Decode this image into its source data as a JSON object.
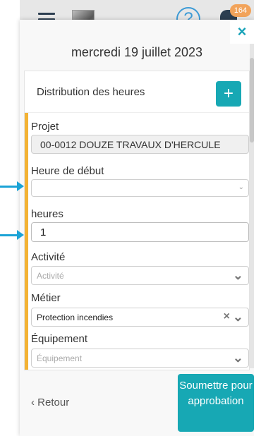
{
  "topbar": {
    "notification_count": "164",
    "help_label": "?"
  },
  "modal": {
    "close_label": "×",
    "date": "mercredi 19 juillet 2023",
    "card_title": "Distribution des heures",
    "add_label": "+",
    "fields": {
      "projet": {
        "label": "Projet",
        "value": "00-0012 DOUZE TRAVAUX D'HERCULE"
      },
      "heure_debut": {
        "label": "Heure de début",
        "value": ""
      },
      "heures": {
        "label": "heures",
        "value": "1"
      },
      "activite": {
        "label": "Activité",
        "placeholder": "Activité"
      },
      "metier": {
        "label": "Métier",
        "value": "Protection incendies"
      },
      "equipement": {
        "label": "Équipement",
        "placeholder": "Équipement"
      }
    },
    "back_label": "‹ Retour",
    "submit_label": "Soumettre pour approbation"
  },
  "colors": {
    "accent_teal": "#17a8b4",
    "accent_yellow": "#f3b233",
    "arrow_blue": "#1ba3d6"
  },
  "icons": [
    "hamburger-icon",
    "avatar",
    "help-icon",
    "bell-icon",
    "close-icon",
    "add-icon",
    "chevron-down-icon",
    "clear-icon"
  ]
}
